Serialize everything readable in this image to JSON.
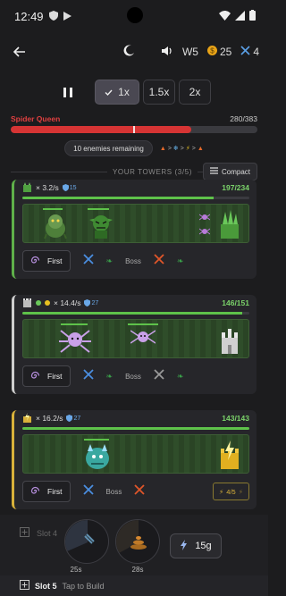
{
  "status": {
    "time": "12:49"
  },
  "header": {
    "wave": "W5",
    "coins": "25",
    "swords": "4"
  },
  "speed": {
    "options": [
      "1x",
      "1.5x",
      "2x"
    ],
    "selected": "1x"
  },
  "boss": {
    "name": "Spider Queen",
    "hp": "280/383",
    "hp_fraction": 0.731
  },
  "enemies": {
    "remaining": "10 enemies remaining"
  },
  "towers_section": {
    "title": "YOUR TOWERS (3/5)",
    "compact_label": "Compact"
  },
  "towers": [
    {
      "rate": "× 3.2/s",
      "armor": "15",
      "hp": "197/234",
      "hp_fraction": 0.842,
      "target": "First",
      "mid_label": "Boss",
      "color": "#5fb04a"
    },
    {
      "rate": "× 14.4/s",
      "armor": "27",
      "hp": "146/151",
      "hp_fraction": 0.967,
      "target": "First",
      "mid_label": "Boss",
      "color": "#cfcfcf"
    },
    {
      "rate": "× 16.2/s",
      "armor": "27",
      "hp": "143/143",
      "hp_fraction": 1.0,
      "target": "First",
      "mid_label": "Boss",
      "level": "4/5",
      "color": "#d8b13a"
    }
  ],
  "slots": {
    "slot4_label": "Slot 4",
    "slot5_label": "Slot 5",
    "slot5_hint": "Tap to Build"
  },
  "abilities": [
    {
      "cooldown": "25s",
      "icon": "fire-bolt-icon"
    },
    {
      "cooldown": "28s",
      "icon": "vortex-icon"
    }
  ],
  "lightning": {
    "cost": "15g"
  },
  "colors": {
    "accent": "#4a4852",
    "boss_red": "#d63434",
    "hp_green": "#5ec24a",
    "gold": "#d8b13a",
    "shield_blue": "#6aa8e8"
  }
}
